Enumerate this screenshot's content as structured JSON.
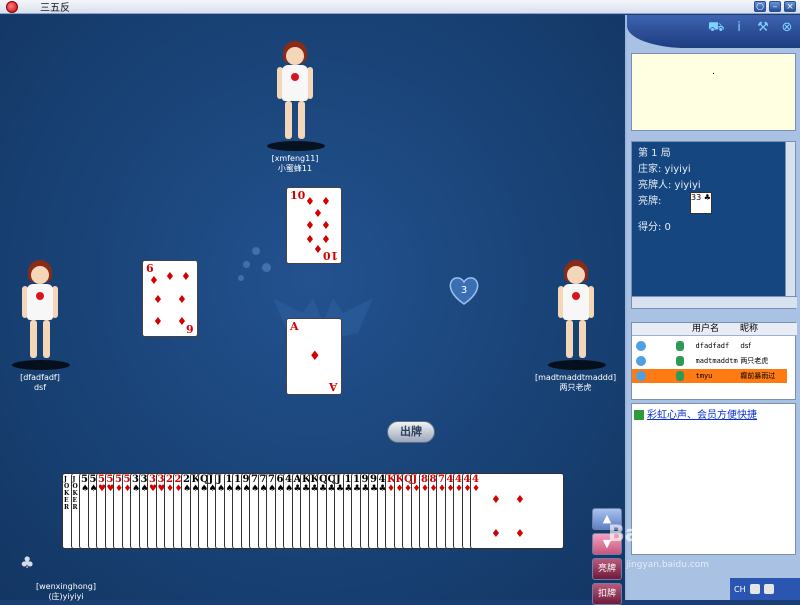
{
  "window": {
    "title": "三五反",
    "buttons": [
      "○",
      "–",
      "×"
    ]
  },
  "players": {
    "top": {
      "account": "[xmfeng11]",
      "nickname": "小蜜蜂11"
    },
    "left": {
      "account": "[dfadfadf]",
      "nickname": "dsf"
    },
    "right": {
      "account": "[madtmaddtmaddd]",
      "nickname": "两只老虎"
    },
    "self": {
      "account": "[wenxinghong]",
      "nickname": "(庄)yiyiyi"
    }
  },
  "played_cards": {
    "left": {
      "rank": "6",
      "suit": "♦"
    },
    "top": {
      "rank": "10",
      "suit": "♦"
    },
    "center": {
      "rank": "A",
      "suit": "♦"
    }
  },
  "score_badge": "3",
  "play_button": "出牌",
  "hand": [
    {
      "r": "JOKER",
      "s": "",
      "c": "#000"
    },
    {
      "r": "JOKER",
      "s": "",
      "c": "#000"
    },
    {
      "r": "5",
      "s": "♠",
      "c": "#000"
    },
    {
      "r": "5",
      "s": "♠",
      "c": "#000"
    },
    {
      "r": "5",
      "s": "♥",
      "c": "#d40000"
    },
    {
      "r": "5",
      "s": "♥",
      "c": "#d40000"
    },
    {
      "r": "5",
      "s": "♦",
      "c": "#d40000"
    },
    {
      "r": "5",
      "s": "♦",
      "c": "#d40000"
    },
    {
      "r": "3",
      "s": "♠",
      "c": "#000"
    },
    {
      "r": "3",
      "s": "♠",
      "c": "#000"
    },
    {
      "r": "3",
      "s": "♥",
      "c": "#d40000"
    },
    {
      "r": "3",
      "s": "♥",
      "c": "#d40000"
    },
    {
      "r": "2",
      "s": "♦",
      "c": "#d40000"
    },
    {
      "r": "2",
      "s": "♦",
      "c": "#d40000"
    },
    {
      "r": "2",
      "s": "♠",
      "c": "#000"
    },
    {
      "r": "K",
      "s": "♠",
      "c": "#000"
    },
    {
      "r": "Q",
      "s": "♠",
      "c": "#000"
    },
    {
      "r": "J",
      "s": "♠",
      "c": "#000"
    },
    {
      "r": "J",
      "s": "♠",
      "c": "#000"
    },
    {
      "r": "10",
      "s": "♠",
      "c": "#000"
    },
    {
      "r": "10",
      "s": "♠",
      "c": "#000"
    },
    {
      "r": "9",
      "s": "♠",
      "c": "#000"
    },
    {
      "r": "7",
      "s": "♠",
      "c": "#000"
    },
    {
      "r": "7",
      "s": "♠",
      "c": "#000"
    },
    {
      "r": "7",
      "s": "♠",
      "c": "#000"
    },
    {
      "r": "6",
      "s": "♠",
      "c": "#000"
    },
    {
      "r": "4",
      "s": "♠",
      "c": "#000"
    },
    {
      "r": "A",
      "s": "♣",
      "c": "#000"
    },
    {
      "r": "K",
      "s": "♣",
      "c": "#000"
    },
    {
      "r": "K",
      "s": "♣",
      "c": "#000"
    },
    {
      "r": "Q",
      "s": "♣",
      "c": "#000"
    },
    {
      "r": "Q",
      "s": "♣",
      "c": "#000"
    },
    {
      "r": "J",
      "s": "♣",
      "c": "#000"
    },
    {
      "r": "10",
      "s": "♣",
      "c": "#000"
    },
    {
      "r": "10",
      "s": "♣",
      "c": "#000"
    },
    {
      "r": "9",
      "s": "♣",
      "c": "#000"
    },
    {
      "r": "9",
      "s": "♣",
      "c": "#000"
    },
    {
      "r": "4",
      "s": "♣",
      "c": "#000"
    },
    {
      "r": "K",
      "s": "♦",
      "c": "#d40000"
    },
    {
      "r": "K",
      "s": "♦",
      "c": "#d40000"
    },
    {
      "r": "Q",
      "s": "♦",
      "c": "#d40000"
    },
    {
      "r": "J",
      "s": "♦",
      "c": "#d40000"
    },
    {
      "r": "8",
      "s": "♦",
      "c": "#d40000"
    },
    {
      "r": "8",
      "s": "♦",
      "c": "#d40000"
    },
    {
      "r": "7",
      "s": "♦",
      "c": "#d40000"
    },
    {
      "r": "4",
      "s": "♦",
      "c": "#d40000"
    },
    {
      "r": "4",
      "s": "♦",
      "c": "#d40000"
    },
    {
      "r": "4",
      "s": "♦",
      "c": "#d40000"
    },
    {
      "r": "4",
      "s": "♦",
      "c": "#d40000"
    }
  ],
  "side_buttons": {
    "up": "▲",
    "down": "▼",
    "t1": "亮牌",
    "t2": "扣牌"
  },
  "panel": {
    "tools": [
      "cart-icon",
      "info-icon",
      "tools-icon",
      "close-icon"
    ],
    "note_text": ".",
    "game_info": {
      "round": "第 1 局",
      "dealer": "庄家: yiyiyi",
      "shower": "亮牌人: yiyiyi",
      "shown": "亮牌:",
      "score": "得分: 0",
      "mini_card": "33 ♣"
    },
    "user_table": {
      "headers": [
        "用户名",
        "昵称"
      ],
      "rows": [
        {
          "user": "dfadfadf",
          "nick": "dsf"
        },
        {
          "user": "madtmaddtm",
          "nick": "两只老虎"
        },
        {
          "user": "tmyu",
          "nick": "癫前暴雨过"
        }
      ]
    },
    "ad_link": "彩虹心声、会员方便快捷"
  },
  "watermark": "Bai 经验",
  "watermark_sub": "jingyan.baidu.com",
  "tray": {
    "lang": "CH"
  },
  "colors": {
    "table": "#184174",
    "accent": "#ff7a12",
    "card_red": "#d40000"
  }
}
